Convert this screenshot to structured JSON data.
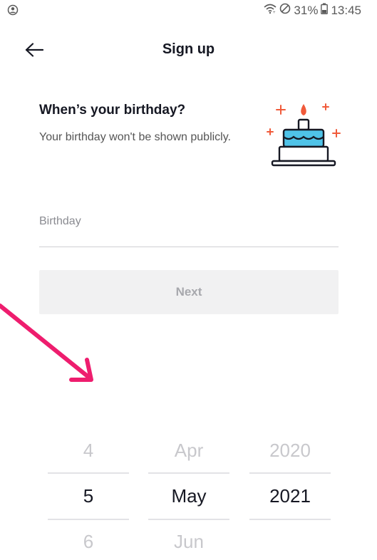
{
  "status_bar": {
    "battery_percent": "31%",
    "time": "13:45",
    "icons": [
      "account-circle-icon",
      "wifi-icon",
      "do-not-disturb-icon",
      "battery-icon"
    ]
  },
  "header": {
    "title": "Sign up",
    "back_icon": "arrow-left-icon"
  },
  "intro": {
    "heading": "When’s your birthday?",
    "subtext": "Your birthday won't be shown publicly.",
    "illustration": "birthday-cake-icon"
  },
  "birthday_field": {
    "placeholder": "Birthday",
    "value": ""
  },
  "next_button": {
    "label": "Next",
    "enabled": false
  },
  "annotation": {
    "arrow_color": "#EE1D6E"
  },
  "picker": {
    "day": {
      "above": "4",
      "selected": "5",
      "below": "6"
    },
    "month": {
      "above": "Apr",
      "selected": "May",
      "below": "Jun"
    },
    "year": {
      "above": "2020",
      "selected": "2021",
      "below": ""
    }
  },
  "colors": {
    "text_primary": "#161823",
    "text_secondary": "#555555",
    "button_disabled_bg": "#F1F1F2",
    "button_disabled_text": "#A7A8AD",
    "cake_accent": "#4FC3E8",
    "candle_flame": "#F05A3A",
    "sparkle": "#F05A3A"
  }
}
